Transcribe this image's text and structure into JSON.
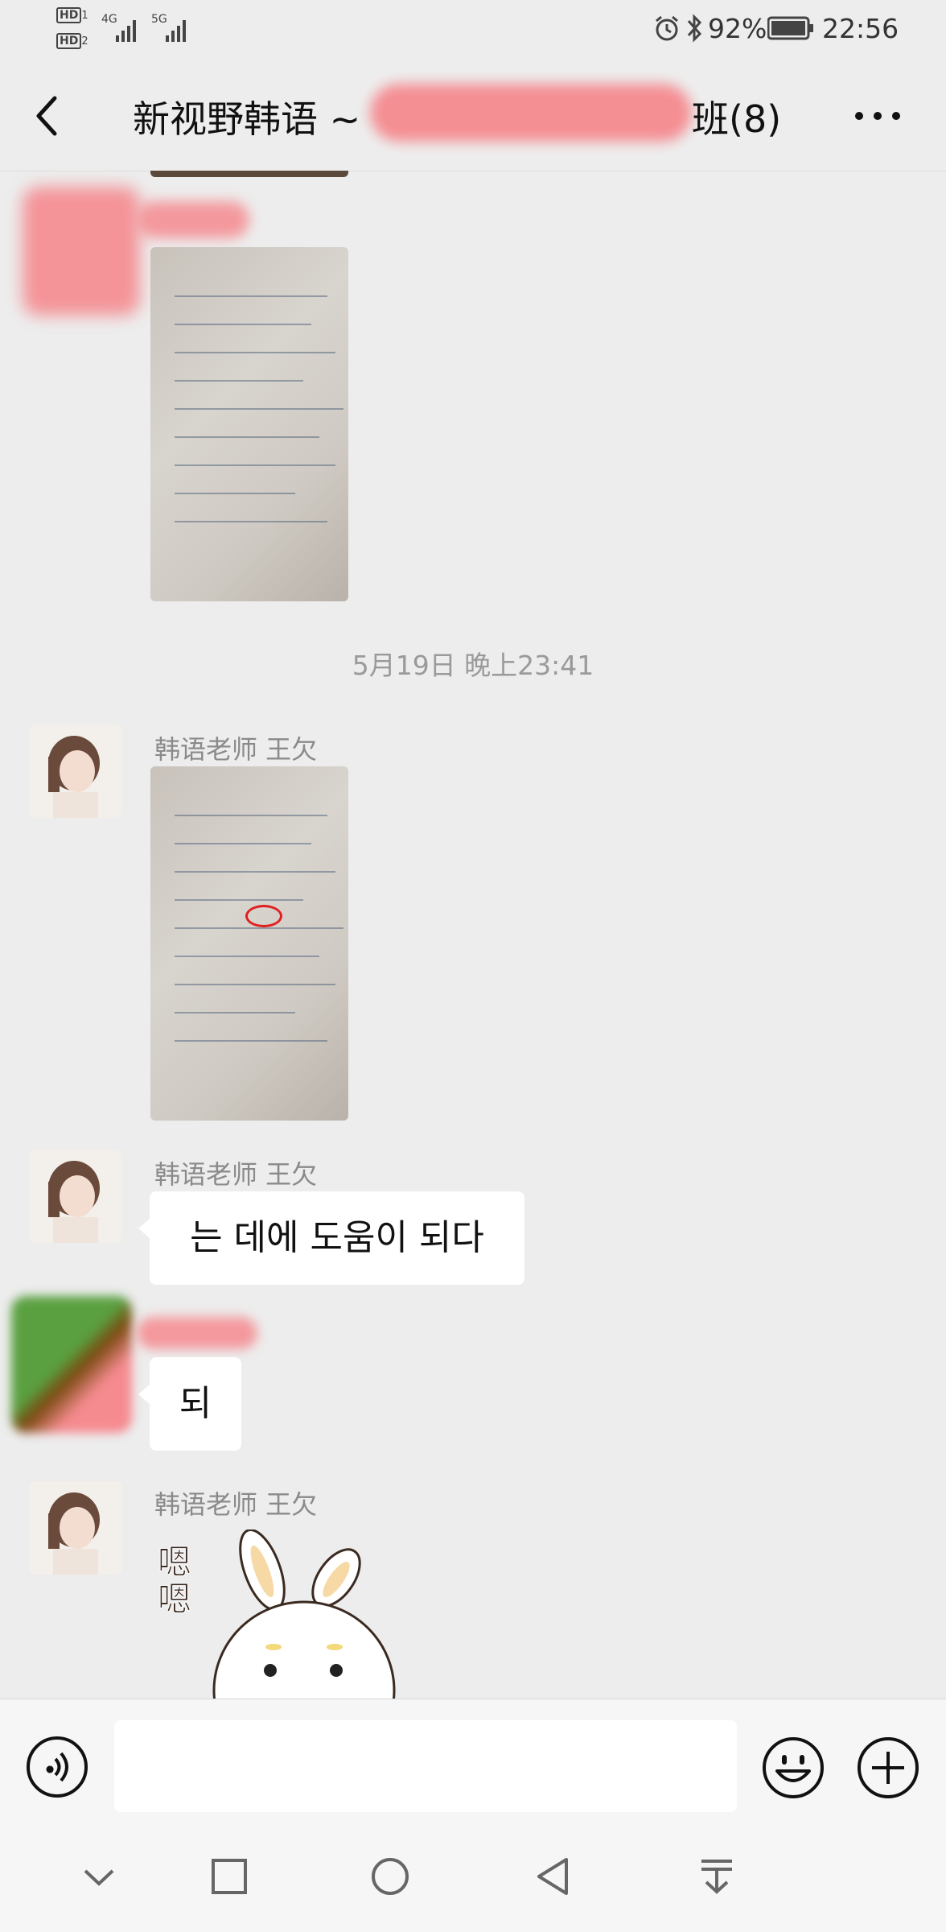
{
  "status_bar": {
    "hd1": "HD",
    "hd1_sub": "1",
    "hd2": "HD",
    "hd2_sub": "2",
    "net1": "4G",
    "net2": "5G",
    "battery_pct": "92%",
    "time": "22:56"
  },
  "header": {
    "title_prefix": "新视野韩语 ~",
    "title_suffix": "班(8)"
  },
  "timestamp": "5月19日 晚上23:41",
  "messages": [
    {
      "sender": "韩语老师 王欠",
      "kind": "image"
    },
    {
      "sender": "韩语老师 王欠",
      "kind": "text",
      "text": "는 데에 도움이 되다"
    },
    {
      "kind": "text",
      "text": "되"
    },
    {
      "sender": "韩语老师 王欠",
      "kind": "sticker",
      "sticker_text": "嗯嗯"
    }
  ],
  "colors": {
    "background": "#ededed",
    "bubble": "#ffffff",
    "name": "#8a8a8a",
    "redaction": "#f58a8f"
  }
}
